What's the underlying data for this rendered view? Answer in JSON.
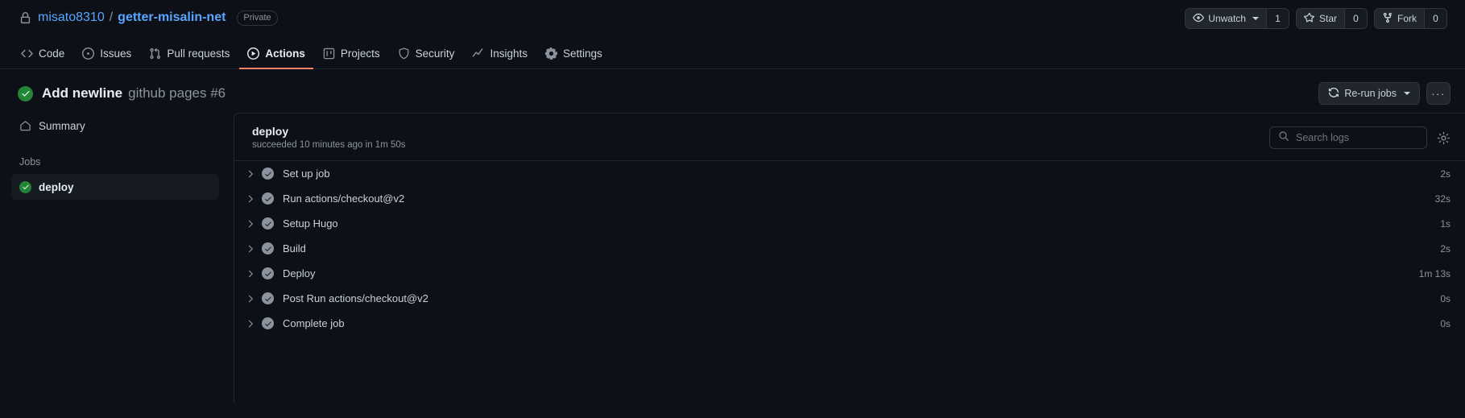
{
  "repo": {
    "lock_icon": "lock-icon",
    "owner": "misato8310",
    "separator": "/",
    "name": "getter-misalin-net",
    "visibility": "Private"
  },
  "header_actions": {
    "watch": {
      "icon": "eye-icon",
      "label": "Unwatch",
      "count": "1"
    },
    "star": {
      "icon": "star-icon",
      "label": "Star",
      "count": "0"
    },
    "fork": {
      "icon": "fork-icon",
      "label": "Fork",
      "count": "0"
    }
  },
  "nav_tabs": [
    {
      "label": "Code",
      "icon": "code-icon",
      "selected": false
    },
    {
      "label": "Issues",
      "icon": "issue-opened-icon",
      "selected": false
    },
    {
      "label": "Pull requests",
      "icon": "git-pull-request-icon",
      "selected": false
    },
    {
      "label": "Actions",
      "icon": "play-icon",
      "selected": true
    },
    {
      "label": "Projects",
      "icon": "project-icon",
      "selected": false
    },
    {
      "label": "Security",
      "icon": "shield-icon",
      "selected": false
    },
    {
      "label": "Insights",
      "icon": "graph-icon",
      "selected": false
    },
    {
      "label": "Settings",
      "icon": "gear-icon",
      "selected": false
    }
  ],
  "run": {
    "status_icon": "check-circle-icon",
    "title": "Add newline",
    "subtitle": "github pages #6",
    "rerun_label": "Re-run jobs",
    "rerun_icon": "sync-icon",
    "kebab_label": "···"
  },
  "sidebar": {
    "summary": {
      "label": "Summary",
      "icon": "home-icon"
    },
    "jobs_heading": "Jobs",
    "jobs": [
      {
        "label": "deploy",
        "status_icon": "check-circle-icon",
        "selected": true
      }
    ]
  },
  "log_panel": {
    "job_name": "deploy",
    "job_status": "succeeded 10 minutes ago in 1m 50s",
    "search_placeholder": "Search logs",
    "search_value": "",
    "search_icon": "search-icon",
    "settings_icon": "gear-icon",
    "steps": [
      {
        "name": "Set up job",
        "duration": "2s",
        "status_icon": "check-icon",
        "chevron": "chevron-right-icon"
      },
      {
        "name": "Run actions/checkout@v2",
        "duration": "32s",
        "status_icon": "check-icon",
        "chevron": "chevron-right-icon"
      },
      {
        "name": "Setup Hugo",
        "duration": "1s",
        "status_icon": "check-icon",
        "chevron": "chevron-right-icon"
      },
      {
        "name": "Build",
        "duration": "2s",
        "status_icon": "check-icon",
        "chevron": "chevron-right-icon"
      },
      {
        "name": "Deploy",
        "duration": "1m 13s",
        "status_icon": "check-icon",
        "chevron": "chevron-right-icon"
      },
      {
        "name": "Post Run actions/checkout@v2",
        "duration": "0s",
        "status_icon": "check-icon",
        "chevron": "chevron-right-icon"
      },
      {
        "name": "Complete job",
        "duration": "0s",
        "status_icon": "check-icon",
        "chevron": "chevron-right-icon"
      }
    ]
  },
  "colors": {
    "background": "#0d1117",
    "accent_link": "#58a6ff",
    "success": "#238636",
    "tab_underline": "#f78166",
    "muted_text": "#8b949e"
  }
}
